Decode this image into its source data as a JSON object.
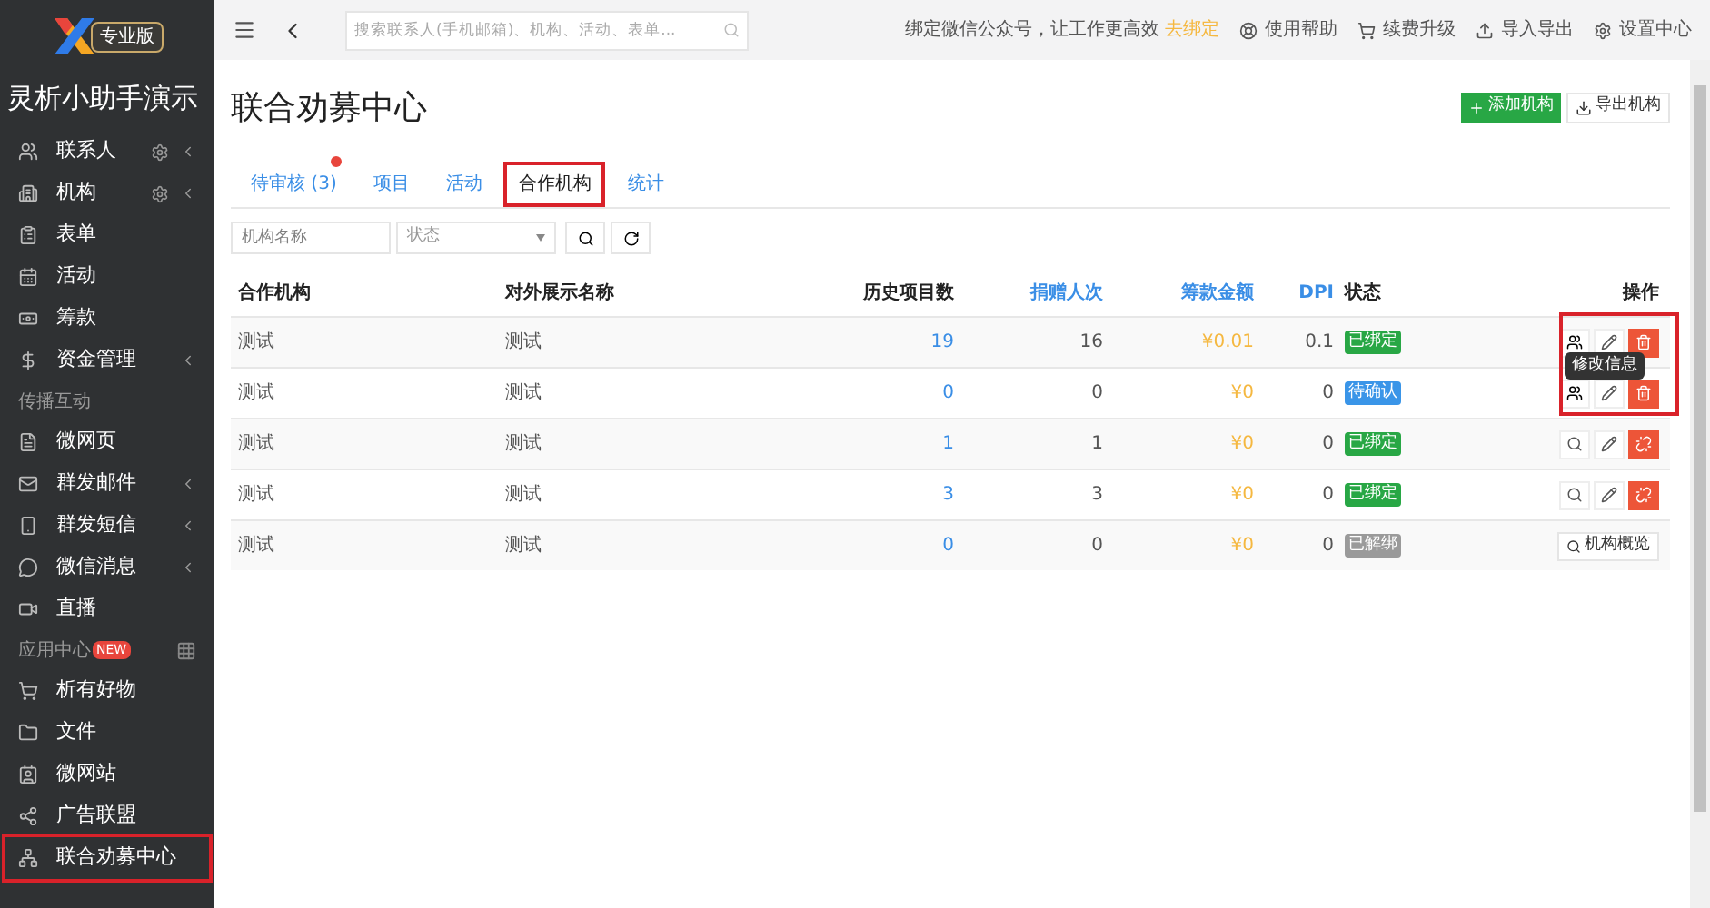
{
  "brand": {
    "edition": "专业版",
    "title": "灵析小助手演示"
  },
  "sidebar": {
    "items": [
      {
        "kind": "item",
        "label": "联系人",
        "gear": true,
        "caret": true,
        "highlighted": false
      },
      {
        "kind": "item",
        "label": "机构",
        "gear": true,
        "caret": true,
        "highlighted": false
      },
      {
        "kind": "item",
        "label": "表单",
        "gear": false,
        "caret": false,
        "highlighted": false
      },
      {
        "kind": "item",
        "label": "活动",
        "gear": false,
        "caret": false,
        "highlighted": false
      },
      {
        "kind": "item",
        "label": "筹款",
        "gear": false,
        "caret": false,
        "highlighted": false
      },
      {
        "kind": "item",
        "label": "资金管理",
        "gear": false,
        "caret": true,
        "highlighted": false
      },
      {
        "kind": "header",
        "label": "传播互动"
      },
      {
        "kind": "item",
        "label": "微网页",
        "gear": false,
        "caret": false,
        "highlighted": false
      },
      {
        "kind": "item",
        "label": "群发邮件",
        "gear": false,
        "caret": true,
        "highlighted": false
      },
      {
        "kind": "item",
        "label": "群发短信",
        "gear": false,
        "caret": true,
        "highlighted": false
      },
      {
        "kind": "item",
        "label": "微信消息",
        "gear": false,
        "caret": true,
        "highlighted": false
      },
      {
        "kind": "item",
        "label": "直播",
        "gear": false,
        "caret": false,
        "highlighted": false
      },
      {
        "kind": "header",
        "label": "应用中心",
        "badge": "NEW"
      },
      {
        "kind": "item",
        "label": "析有好物",
        "gear": false,
        "caret": false,
        "highlighted": false
      },
      {
        "kind": "item",
        "label": "文件",
        "gear": false,
        "caret": false,
        "highlighted": false
      },
      {
        "kind": "item",
        "label": "微网站",
        "gear": false,
        "caret": false,
        "highlighted": false
      },
      {
        "kind": "item",
        "label": "广告联盟",
        "gear": false,
        "caret": false,
        "highlighted": false
      },
      {
        "kind": "item",
        "label": "联合劝募中心",
        "gear": false,
        "caret": false,
        "highlighted": true
      }
    ]
  },
  "topbar": {
    "search_placeholder": "搜索联系人(手机邮箱)、机构、活动、表单...",
    "notice": "绑定微信公众号，让工作更高效",
    "notice_link": "去绑定",
    "links": [
      "使用帮助",
      "续费升级",
      "导入导出",
      "设置中心"
    ]
  },
  "page": {
    "title": "联合劝募中心",
    "buttons": [
      {
        "label": "添加机构",
        "kind": "primary"
      },
      {
        "label": "导出机构",
        "kind": "default"
      }
    ]
  },
  "tabs": [
    {
      "label": "待审核 (3)",
      "selected": false,
      "dot": true,
      "highlighted": false
    },
    {
      "label": "项目",
      "selected": false,
      "dot": false,
      "highlighted": false
    },
    {
      "label": "活动",
      "selected": false,
      "dot": false,
      "highlighted": false
    },
    {
      "label": "合作机构",
      "selected": true,
      "dot": false,
      "highlighted": true
    },
    {
      "label": "统计",
      "selected": false,
      "dot": false,
      "highlighted": false
    }
  ],
  "filters": {
    "name_placeholder": "机构名称",
    "status_placeholder": "状态"
  },
  "table": {
    "actions_highlighted": true,
    "columns": [
      {
        "label": "合作机构",
        "sortable": false
      },
      {
        "label": "对外展示名称",
        "sortable": false
      },
      {
        "label": "历史项目数",
        "sortable": false
      },
      {
        "label": "捐赠人次",
        "sortable": true
      },
      {
        "label": "筹款金额",
        "sortable": true
      },
      {
        "label": "DPI",
        "sortable": true
      },
      {
        "label": "状态",
        "sortable": false
      },
      {
        "label": "操作",
        "sortable": false
      }
    ],
    "rows": [
      {
        "kind": "manage",
        "org": "测试",
        "display": "测试",
        "projects": "19",
        "donations": "16",
        "amount": "¥0.01",
        "dpi": "0.1",
        "status": "已绑定",
        "color": "#28a745"
      },
      {
        "kind": "manage",
        "org": "测试",
        "display": "测试",
        "projects": "0",
        "donations": "0",
        "amount": "¥0",
        "dpi": "0",
        "status": "待确认",
        "color": "#3a95e8",
        "tooltip": "修改信息"
      },
      {
        "kind": "unbind",
        "org": "测试",
        "display": "测试",
        "projects": "1",
        "donations": "1",
        "amount": "¥0",
        "dpi": "0",
        "status": "已绑定",
        "color": "#28a745"
      },
      {
        "kind": "unbind",
        "org": "测试",
        "display": "测试",
        "projects": "3",
        "donations": "3",
        "amount": "¥0",
        "dpi": "0",
        "status": "已绑定",
        "color": "#28a745"
      },
      {
        "kind": "overview",
        "org": "测试",
        "display": "测试",
        "projects": "0",
        "donations": "0",
        "amount": "¥0",
        "dpi": "0",
        "status": "已解绑",
        "color": "#9a9a9a",
        "action_label": "机构概览"
      }
    ]
  }
}
